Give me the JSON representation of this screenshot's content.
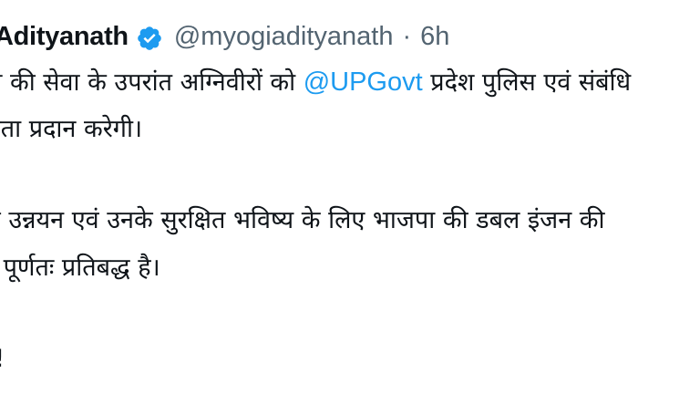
{
  "tweet": {
    "display_name": "Adityanath",
    "handle": "@myogiadityanath",
    "separator": "·",
    "time": "6h",
    "verified_color": "#1d9bf0",
    "paragraph1": {
      "line1_before": "ती की सेवा के उपरांत अग्निवीरों को ",
      "mention": "@UPGovt",
      "line1_after": " प्रदेश पुलिस एवं संबंधि",
      "line2": "कता प्रदान करेगी।"
    },
    "paragraph2": {
      "line1": " के उन्नयन एवं उनके सुरक्षित भविष्य के लिए भाजपा की डबल इंजन की",
      "line2": " व पूर्णतः प्रतिबद्ध है।"
    },
    "paragraph3": {
      "line1": "द!"
    }
  }
}
